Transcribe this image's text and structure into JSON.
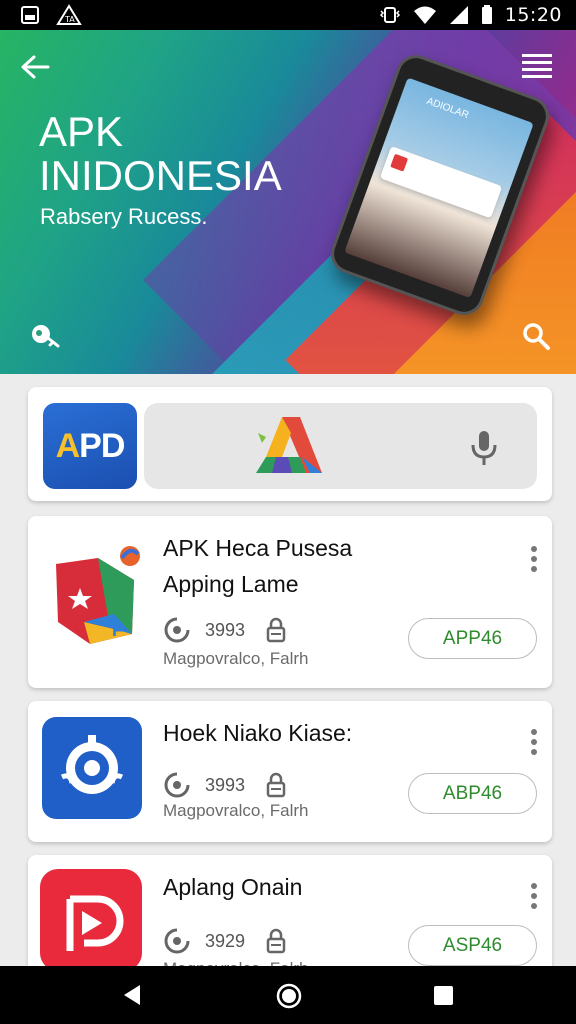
{
  "status_bar": {
    "time": "15:20",
    "icons": [
      "image-notification-icon",
      "warning-icon",
      "vibrate-icon",
      "wifi-icon",
      "signal-icon",
      "battery-icon"
    ]
  },
  "hero": {
    "title_line1": "APK",
    "title_line2": "INIDONESIA",
    "subtitle": "Rabsery Rucess.",
    "phone_screen_text": "ADIOLAR",
    "icons": [
      "back-arrow-icon",
      "hamburger-menu-icon",
      "key-icon",
      "search-icon"
    ]
  },
  "search": {
    "logo_text_a": "A",
    "logo_text_pd": "PD",
    "placeholder": "",
    "icons": [
      "colorful-a-logo-icon",
      "microphone-icon"
    ]
  },
  "apps": [
    {
      "name_line1": "APK Heca Pusesa",
      "name_line2": "Apping Lame",
      "count": "3993",
      "subtitle": "Magpovralco,  Falrh",
      "button": "APP46"
    },
    {
      "name_line1": "Hoek Niako Kiase:",
      "count": "3993",
      "subtitle": "Magpovralco,  Falrh",
      "button": "ABP46"
    },
    {
      "name_line1": "Aplang Onain",
      "count": "3929",
      "subtitle": "Magpovralco,  Falrh",
      "button": "ASP46"
    }
  ],
  "nav": {
    "icons": [
      "nav-back-icon",
      "nav-home-icon",
      "nav-recents-icon"
    ]
  },
  "colors": {
    "install_text": "#2e8b2e",
    "hero_green": "#27b463",
    "hero_purple": "#8b2d8f",
    "hero_orange": "#f07a23"
  }
}
